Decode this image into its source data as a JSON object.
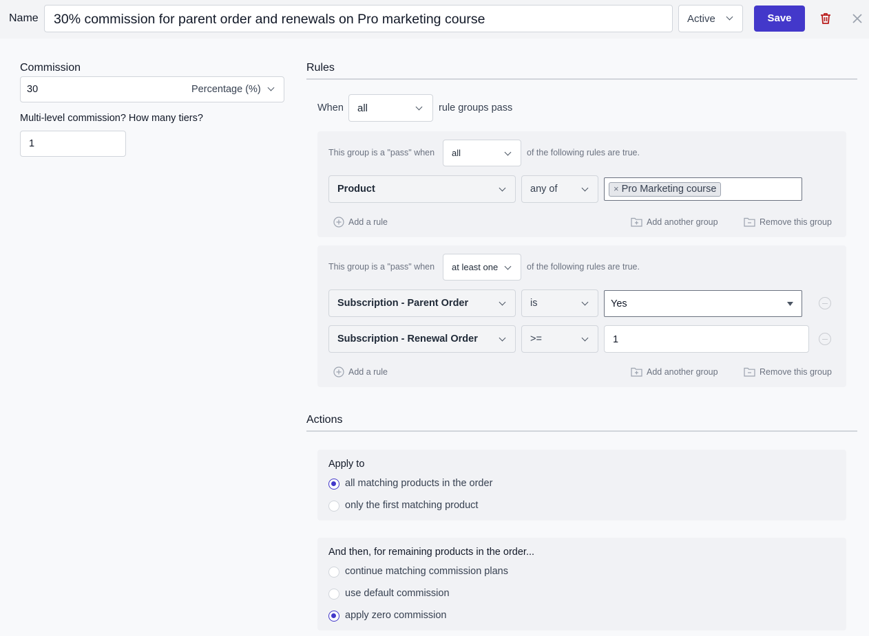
{
  "header": {
    "name_label": "Name",
    "name_value": "30% commission for parent order and renewals on Pro marketing course",
    "status": "Active",
    "save_label": "Save"
  },
  "commission": {
    "label": "Commission",
    "value": "30",
    "type": "Percentage (%)",
    "tiers_label": "Multi-level commission? How many tiers?",
    "tiers_value": "1"
  },
  "rules": {
    "title": "Rules",
    "when_label": "When",
    "when_value": "all",
    "pass_label": "rule groups pass",
    "groups": [
      {
        "prefix": "This group is a \"pass\" when",
        "mode": "all",
        "suffix": "of the following rules are true.",
        "rows": [
          {
            "field": "Product",
            "op": "any of",
            "tag": "Pro Marketing course"
          }
        ],
        "add_rule": "Add a rule",
        "add_group": "Add another group",
        "remove_group": "Remove this group"
      },
      {
        "prefix": "This group is a \"pass\" when",
        "mode": "at least one",
        "suffix": "of the following rules are true.",
        "rows": [
          {
            "field": "Subscription - Parent Order",
            "op": "is",
            "value": "Yes"
          },
          {
            "field": "Subscription - Renewal Order",
            "op": ">=",
            "value": "1"
          }
        ],
        "add_rule": "Add a rule",
        "add_group": "Add another group",
        "remove_group": "Remove this group"
      }
    ]
  },
  "actions": {
    "title": "Actions",
    "apply_to": {
      "label": "Apply to",
      "options": [
        "all matching products in the order",
        "only the first matching product"
      ],
      "selected": 0
    },
    "remaining": {
      "label": "And then, for remaining products in the order...",
      "options": [
        "continue matching commission plans",
        "use default commission",
        "apply zero commission"
      ],
      "selected": 2
    }
  },
  "colors": {
    "accent": "#4338ca",
    "danger": "#b91c1c",
    "background": "#f8f9fb",
    "group_bg": "#f1f2f5"
  },
  "icons": [
    "trash-icon",
    "close-icon",
    "chevron-down-icon",
    "plus-circle-icon",
    "folder-plus-icon",
    "folder-minus-icon",
    "minus-circle-icon",
    "caret-down-icon"
  ]
}
